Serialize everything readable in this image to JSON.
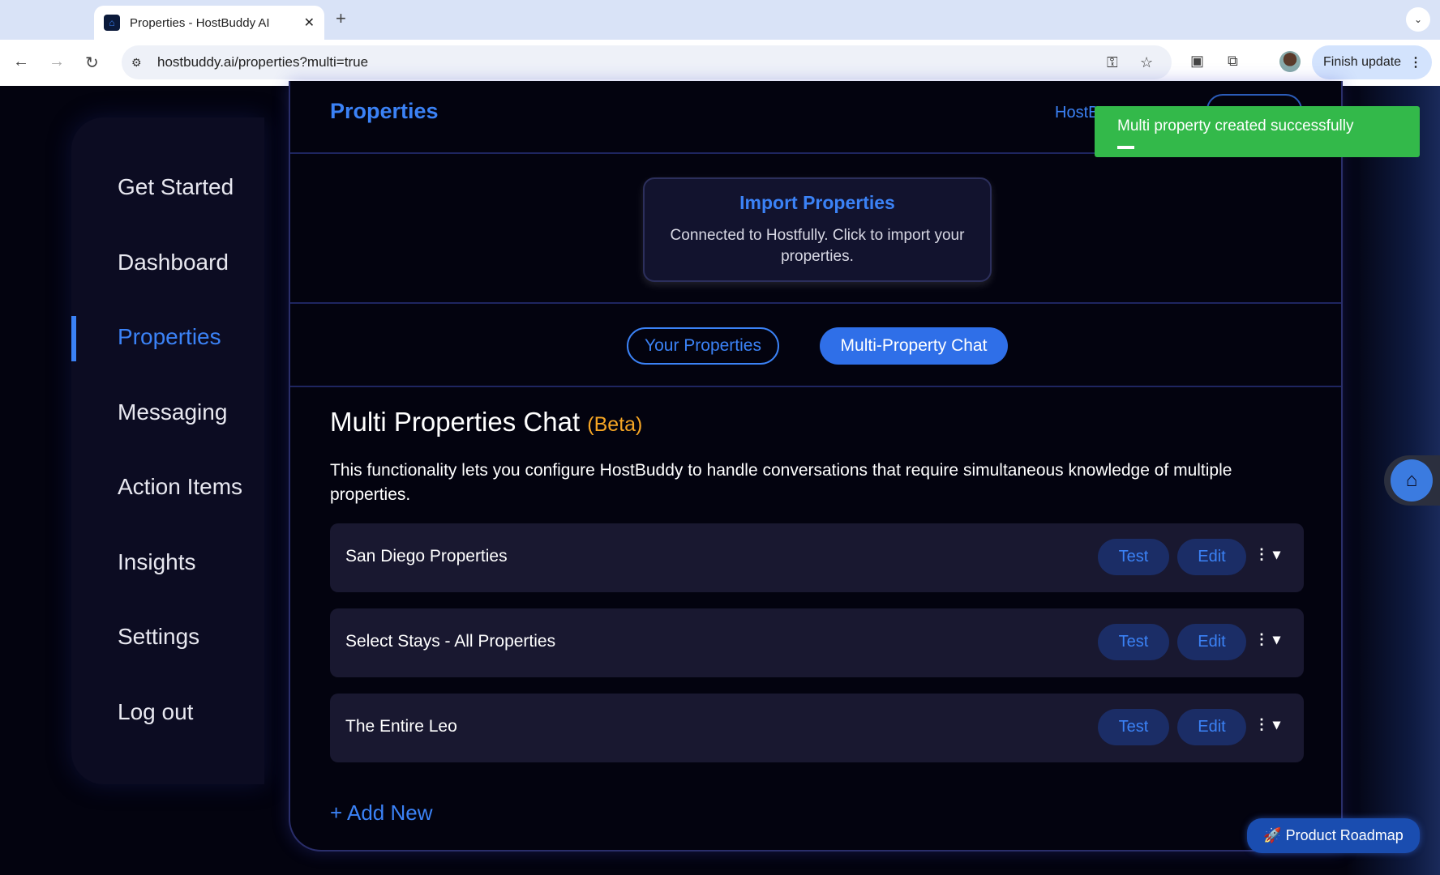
{
  "browser": {
    "tab_title": "Properties - HostBuddy AI",
    "url": "hostbuddy.ai/properties?multi=true",
    "finish_update": "Finish update"
  },
  "sidebar": {
    "items": [
      {
        "label": "Get Started"
      },
      {
        "label": "Dashboard"
      },
      {
        "label": "Properties",
        "active": true
      },
      {
        "label": "Messaging"
      },
      {
        "label": "Action Items"
      },
      {
        "label": "Insights"
      },
      {
        "label": "Settings"
      },
      {
        "label": "Log out"
      }
    ]
  },
  "header": {
    "title": "Properties",
    "partial_link": "HostB"
  },
  "import": {
    "title": "Import Properties",
    "description": "Connected to Hostfully. Click to import your properties."
  },
  "tabs": [
    {
      "label": "Your Properties"
    },
    {
      "label": "Multi-Property Chat",
      "active": true
    }
  ],
  "section": {
    "title": "Multi Properties Chat",
    "badge": "(Beta)",
    "description": "This functionality lets you configure HostBuddy to handle conversations that require simultaneous knowledge of multiple properties."
  },
  "groups": [
    {
      "name": "San Diego Properties",
      "test": "Test",
      "edit": "Edit"
    },
    {
      "name": "Select Stays - All Properties",
      "test": "Test",
      "edit": "Edit"
    },
    {
      "name": "The Entire Leo",
      "test": "Test",
      "edit": "Edit"
    }
  ],
  "add_new": "+ Add New",
  "toast": {
    "message": "Multi property created successfully"
  },
  "roadmap": "🚀 Product Roadmap",
  "colors": {
    "accent": "#3b82f6",
    "toast": "#33b94a",
    "beta": "#f5a524",
    "background": "#03030f"
  }
}
